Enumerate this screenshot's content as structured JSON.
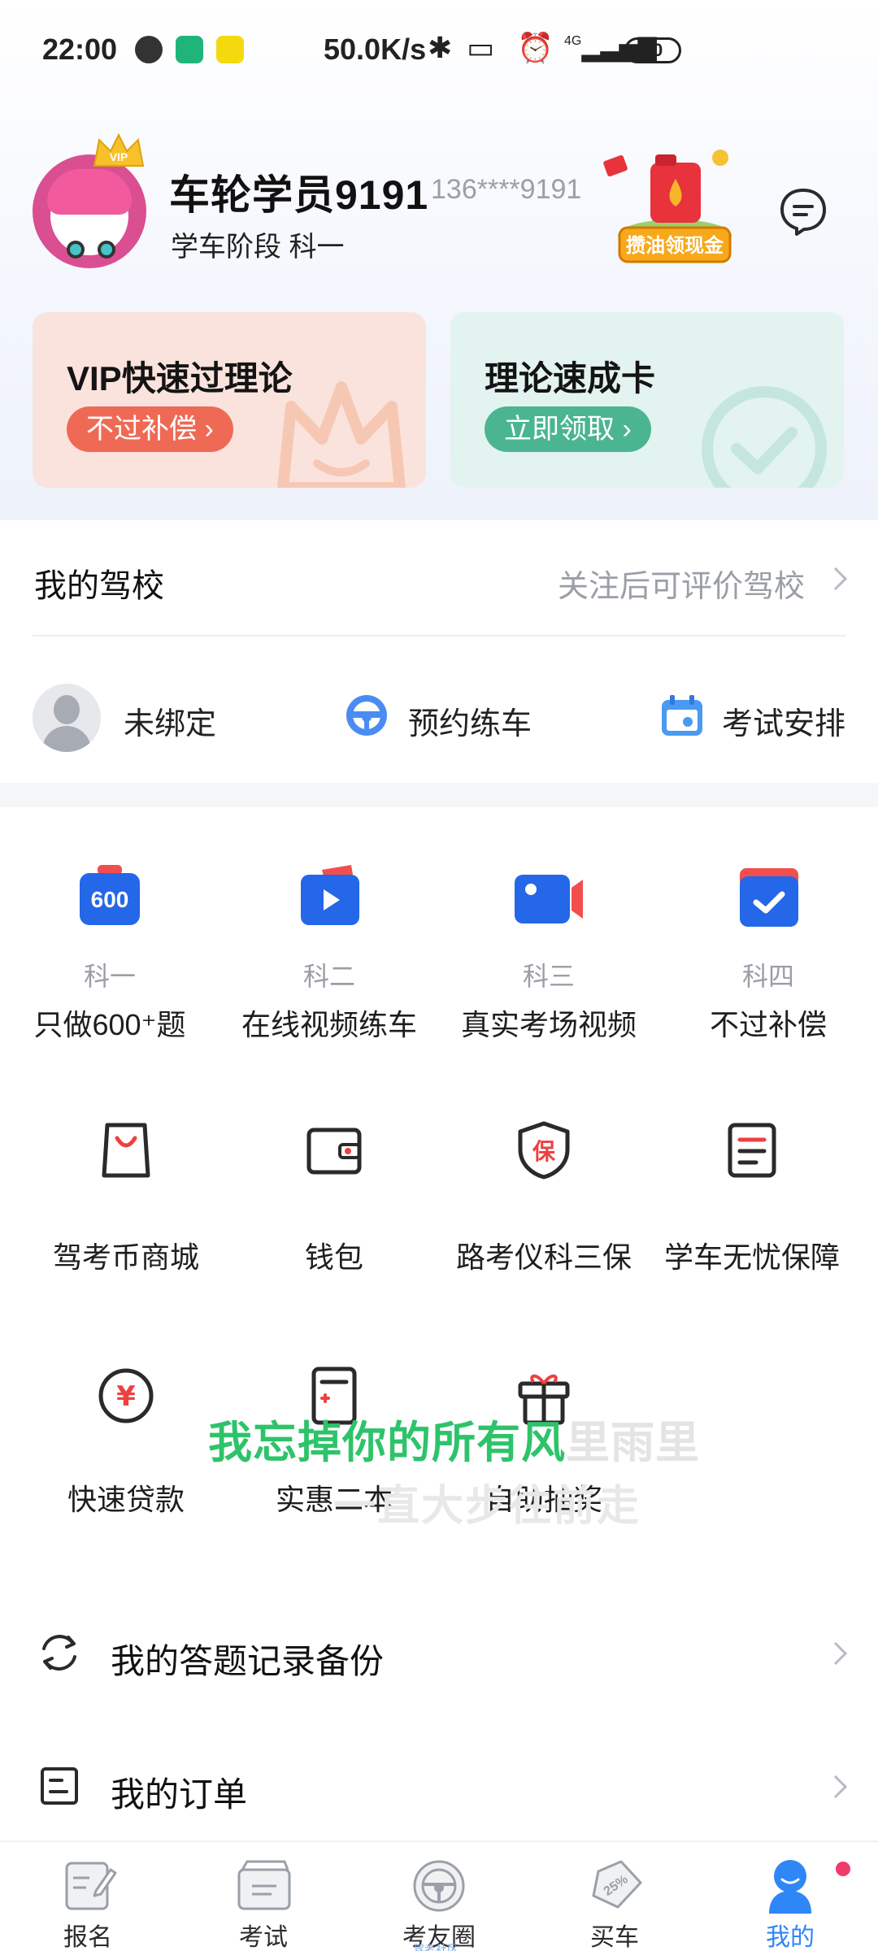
{
  "status_bar": {
    "time": "22:00",
    "speed": "50.0K/s",
    "network": "4G",
    "battery": "80"
  },
  "profile": {
    "username": "车轮学员9191",
    "phone": "136****9191",
    "stage": "学车阶段 科一",
    "vip_badge": "VIP",
    "promo_text": "攒油领现金"
  },
  "cards": [
    {
      "title": "VIP快速过理论",
      "button": "不过补偿"
    },
    {
      "title": "理论速成卡",
      "button": "立即领取"
    }
  ],
  "school": {
    "title": "我的驾校",
    "hint": "关注后可评价驾校",
    "items": [
      {
        "label": "未绑定",
        "icon": "person-avatar-icon"
      },
      {
        "label": "预约练车",
        "icon": "steering-wheel-icon"
      },
      {
        "label": "考试安排",
        "icon": "calendar-icon"
      }
    ]
  },
  "subjects": [
    {
      "sub": "科一",
      "label": "只做600⁺题",
      "icon": "600-badge-icon",
      "icon_text": "600"
    },
    {
      "sub": "科二",
      "label": "在线视频练车",
      "icon": "video-play-icon"
    },
    {
      "sub": "科三",
      "label": "真实考场视频",
      "icon": "camera-icon"
    },
    {
      "sub": "科四",
      "label": "不过补偿",
      "icon": "checkmark-card-icon"
    }
  ],
  "services": [
    {
      "label": "驾考币商城",
      "icon": "shopping-bag-icon"
    },
    {
      "label": "钱包",
      "icon": "wallet-icon"
    },
    {
      "label": "路考仪科三保",
      "icon": "shield-bao-icon",
      "icon_text": "保"
    },
    {
      "label": "学车无忧保障",
      "icon": "document-icon"
    },
    {
      "label": "快速贷款",
      "icon": "yen-coin-icon",
      "icon_text": "¥"
    },
    {
      "label": "实惠二本",
      "icon": "calculator-icon"
    },
    {
      "label": "自助抽奖",
      "icon": "gift-icon"
    }
  ],
  "overlay_lyrics": {
    "line1_highlight": "我忘掉你的所有风",
    "line1_rest": "里雨里",
    "line2": "一直大步往前走"
  },
  "list": [
    {
      "label": "我的答题记录备份",
      "icon": "sync-icon"
    },
    {
      "label": "我的订单",
      "icon": "order-icon"
    }
  ],
  "tabs": [
    {
      "label": "报名",
      "icon": "signup-icon"
    },
    {
      "label": "考试",
      "icon": "exam-icon"
    },
    {
      "label": "考友圈",
      "icon": "steering-wheel-tab-icon",
      "tiny": "驾考社区"
    },
    {
      "label": "买车",
      "icon": "discount-tag-icon",
      "tag_text": "25%"
    },
    {
      "label": "我的",
      "icon": "profile-mascot-icon"
    }
  ],
  "colors": {
    "accent_blue": "#2f86f6",
    "icon_blue": "#2467e8",
    "vip_card": "#fbe3dd",
    "vip_button": "#ef6a55",
    "theory_card": "#e3f3ef",
    "theory_button": "#4bb591",
    "lyric_green": "#2ec36a",
    "notification_dot": "#f03b6a"
  }
}
